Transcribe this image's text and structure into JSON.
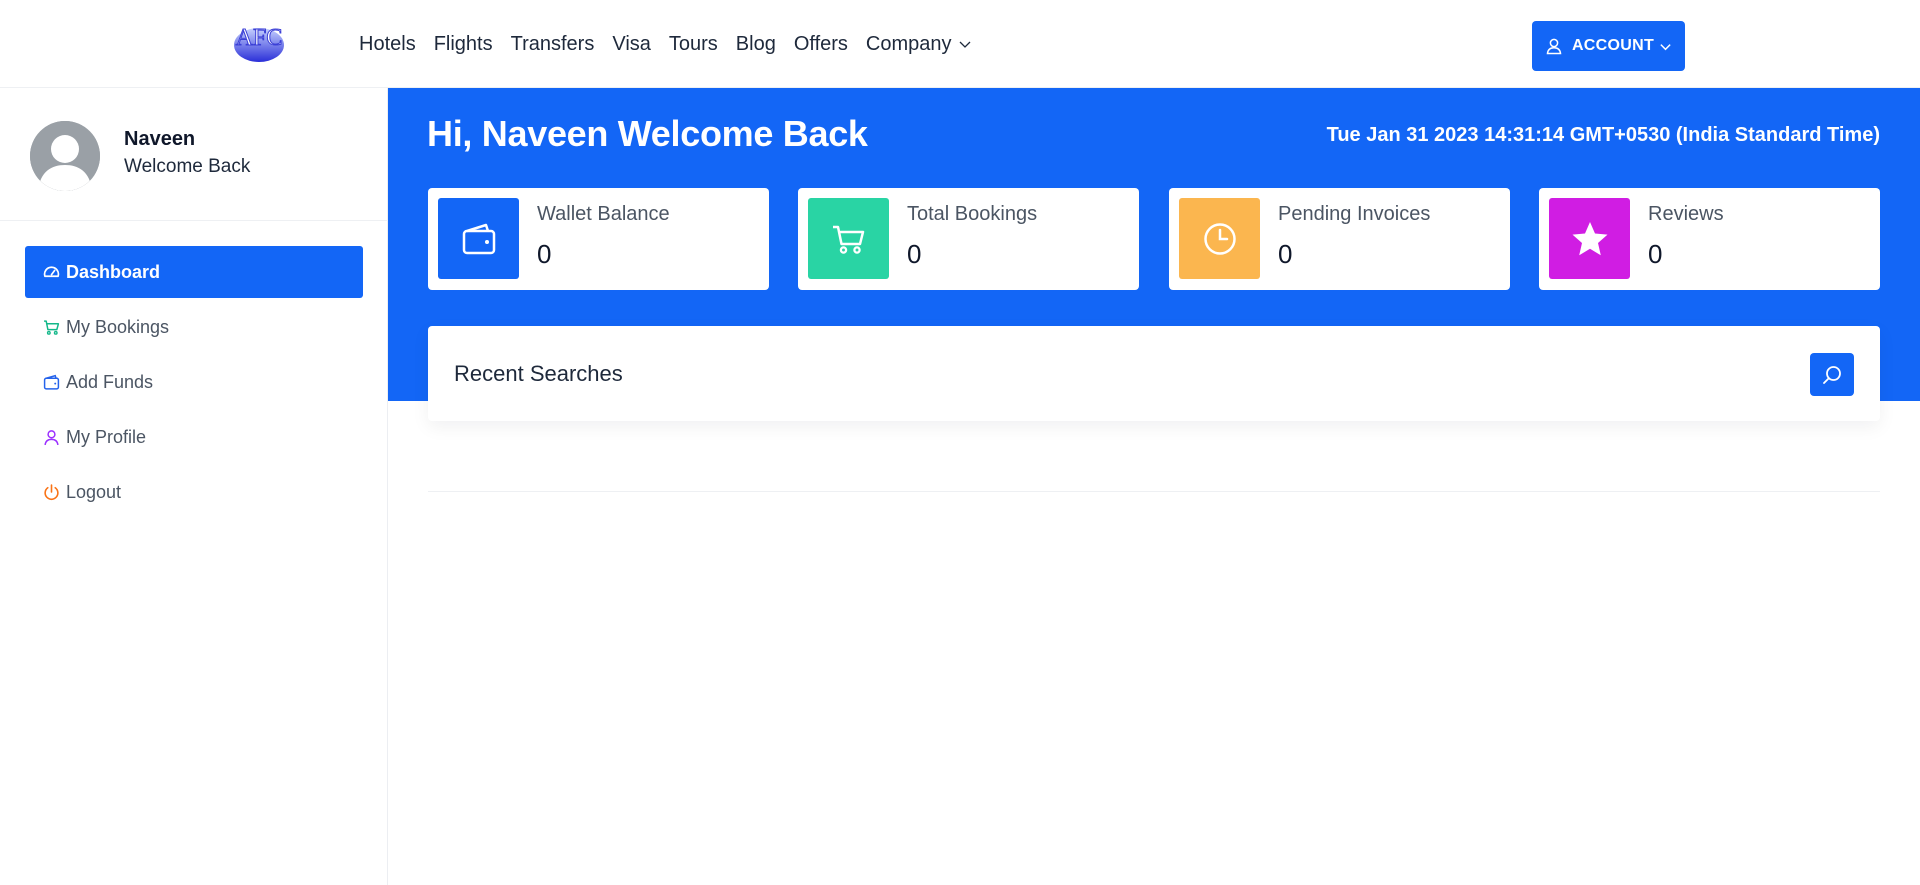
{
  "header": {
    "logo_text": "AFC",
    "nav": [
      "Hotels",
      "Flights",
      "Transfers",
      "Visa",
      "Tours",
      "Blog",
      "Offers",
      "Company"
    ],
    "account_label": "ACCOUNT"
  },
  "sidebar": {
    "user_name": "Naveen",
    "user_subtitle": "Welcome Back",
    "items": [
      {
        "label": "Dashboard",
        "icon": "dashboard-gauge-icon",
        "active": true
      },
      {
        "label": "My Bookings",
        "icon": "cart-icon",
        "color": "#14b88a"
      },
      {
        "label": "Add Funds",
        "icon": "wallet-icon",
        "color": "#2563eb"
      },
      {
        "label": "My Profile",
        "icon": "user-icon",
        "color": "#9b30ff"
      },
      {
        "label": "Logout",
        "icon": "power-icon",
        "color": "#f97316"
      }
    ]
  },
  "main": {
    "greeting": "Hi, Naveen Welcome Back",
    "datetime": "Tue Jan 31 2023 14:31:14 GMT+0530 (India Standard Time)",
    "stats": [
      {
        "label": "Wallet Balance",
        "value": "0",
        "icon": "wallet-icon",
        "color": "#1366f6"
      },
      {
        "label": "Total Bookings",
        "value": "0",
        "icon": "cart-icon",
        "color": "#29d4a4"
      },
      {
        "label": "Pending Invoices",
        "value": "0",
        "icon": "clock-icon",
        "color": "#fbb64f"
      },
      {
        "label": "Reviews",
        "value": "0",
        "icon": "star-icon",
        "color": "#d01de3"
      }
    ],
    "recent_searches_title": "Recent Searches"
  },
  "colors": {
    "primary": "#1366f6",
    "bookings": "#29d4a4",
    "invoices": "#fbb64f",
    "reviews": "#d01de3"
  }
}
